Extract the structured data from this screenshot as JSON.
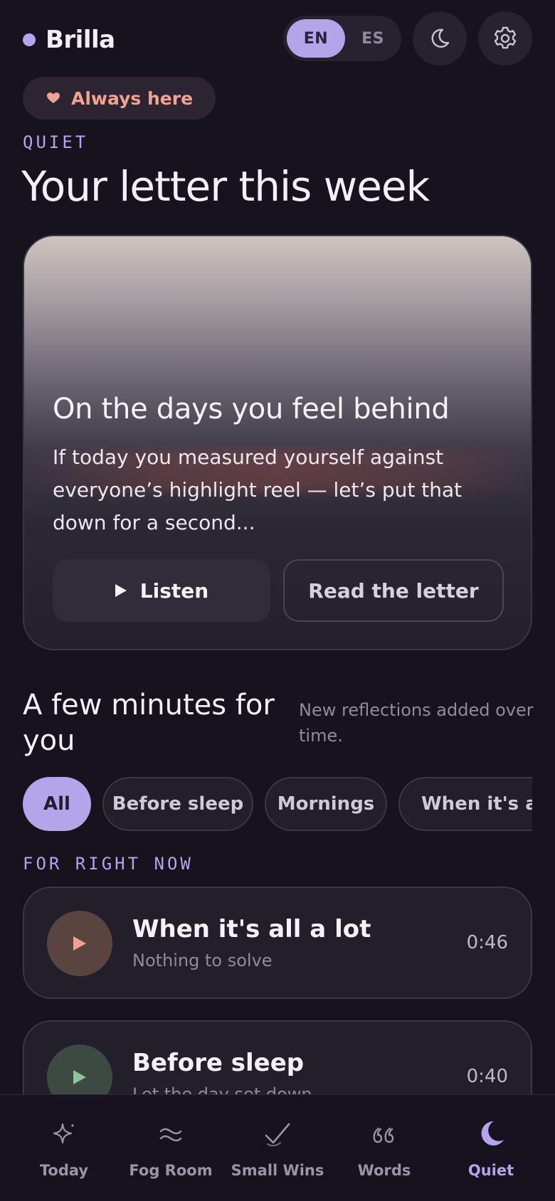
{
  "app": {
    "name": "Brilla"
  },
  "header": {
    "lang_options": [
      "EN",
      "ES"
    ],
    "lang_selected": "EN"
  },
  "badge": {
    "label": "Always here"
  },
  "page": {
    "eyebrow": "QUIET",
    "title": "Your letter this week"
  },
  "letter": {
    "title": "On the days you feel behind",
    "body": "If today you measured yourself against everyone’s highlight reel — let’s put that down for a second...",
    "listen_label": "Listen",
    "read_label": "Read the letter"
  },
  "section": {
    "title": "A few minutes for you",
    "subtitle": "New reflections added over time."
  },
  "filters": {
    "items": [
      "All",
      "Before sleep",
      "Mornings",
      "When it's a lot"
    ],
    "selected": "All"
  },
  "now": {
    "eyebrow": "FOR RIGHT NOW",
    "tracks": [
      {
        "title": "When it's all a lot",
        "subtitle": "Nothing to solve",
        "duration": "0:46",
        "accent": "#f0a392",
        "bg": "#5a443f"
      },
      {
        "title": "Before sleep",
        "subtitle": "Let the day set down",
        "duration": "0:40",
        "accent": "#8fc49a",
        "bg": "#3c4a42"
      }
    ]
  },
  "nav": {
    "items": [
      {
        "label": "Today",
        "icon": "sparkle-icon"
      },
      {
        "label": "Fog Room",
        "icon": "waves-icon"
      },
      {
        "label": "Small Wins",
        "icon": "check-icon"
      },
      {
        "label": "Words",
        "icon": "quote-icon"
      },
      {
        "label": "Quiet",
        "icon": "moon-icon"
      }
    ],
    "active": "Quiet"
  },
  "colors": {
    "background": "#16131f",
    "accent": "#b6a3ec",
    "badge_text": "#f0a392"
  }
}
